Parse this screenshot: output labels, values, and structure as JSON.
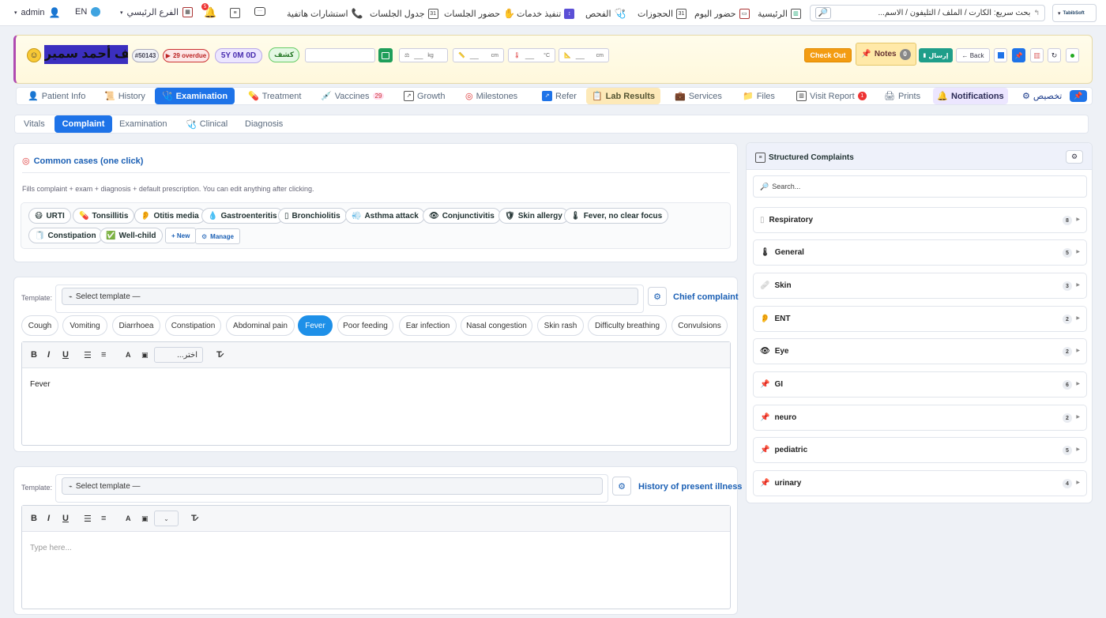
{
  "topnav": {
    "brand": "TabibSoft",
    "quick_search": "بحث سريع: الكارت / الملف / التليفون / الاسم...",
    "items": [
      {
        "label": "الرئيسية",
        "icon": "chart-icon"
      },
      {
        "label": "حضور اليوم",
        "icon": "calendar-icon"
      },
      {
        "label": "الحجوزات",
        "icon": "calendar-icon"
      },
      {
        "label": "الفحص",
        "icon": "stethoscope-icon"
      },
      {
        "label": "تنفيذ خدمات",
        "icon": "service-icon"
      },
      {
        "label": "حضور الجلسات",
        "icon": "hand-icon"
      },
      {
        "label": "جدول الجلسات",
        "icon": "calendar-icon"
      },
      {
        "label": "استشارات هاتفية",
        "icon": "phone-icon"
      }
    ],
    "branch": "الفرع الرئيسي",
    "notif_badge": "5",
    "lang": "EN",
    "user": "admin"
  },
  "patient": {
    "name": "يوسف أحمد سمير",
    "id": "#50143",
    "overdue": "29 overdue",
    "age": "5Y 0M 0D",
    "visit_type": "كشف",
    "weight_unit": "kg",
    "height_unit": "cm",
    "temp_unit": "°C",
    "head_unit": "cm",
    "placeholder_dash": "__",
    "checkout": "Check Out",
    "notes": "Notes",
    "notes_count": "0",
    "send": "إرسال",
    "back": "← Back"
  },
  "main_tabs": [
    {
      "label": "Patient Info",
      "icon": "person-icon"
    },
    {
      "label": "History",
      "icon": "scroll-icon"
    },
    {
      "label": "Examination",
      "icon": "stethoscope-icon"
    },
    {
      "label": "Treatment",
      "icon": "pill-icon"
    },
    {
      "label": "Vaccines",
      "icon": "syringe-icon",
      "badge": "29"
    },
    {
      "label": "Growth",
      "icon": "chart-icon"
    },
    {
      "label": "Milestones",
      "icon": "target-icon"
    },
    {
      "label": "Refer",
      "icon": "share-icon"
    },
    {
      "label": "Lab Results",
      "icon": "clipboard-icon"
    },
    {
      "label": "Services",
      "icon": "bag-icon"
    },
    {
      "label": "Files",
      "icon": "folder-icon"
    },
    {
      "label": "Visit Report",
      "icon": "report-icon",
      "badge": "1"
    },
    {
      "label": "Prints",
      "icon": "printer-icon"
    },
    {
      "label": "Notifications",
      "icon": "bell-icon"
    },
    {
      "label": "تخصيص",
      "icon": "gear-icon"
    }
  ],
  "sub_tabs": [
    "Vitals",
    "Complaint",
    "Examination",
    "Clinical",
    "Diagnosis"
  ],
  "common_cases": {
    "title": "Common cases (one click)",
    "hint": "Fills complaint + exam + diagnosis + default prescription. You can edit anything after clicking.",
    "chips": [
      {
        "label": "URTI",
        "icon": "😷"
      },
      {
        "label": "Tonsillitis",
        "icon": "💊"
      },
      {
        "label": "Otitis media",
        "icon": "👂"
      },
      {
        "label": "Gastroenteritis",
        "icon": "💧"
      },
      {
        "label": "Bronchiolitis",
        "icon": "▯"
      },
      {
        "label": "Asthma attack",
        "icon": "💨"
      },
      {
        "label": "Conjunctivitis",
        "icon": "👁"
      },
      {
        "label": "Skin allergy",
        "icon": "🛡"
      },
      {
        "label": "Fever, no clear focus",
        "icon": "🌡"
      },
      {
        "label": "Constipation",
        "icon": "🧻"
      },
      {
        "label": "Well-child",
        "icon": "✅"
      }
    ],
    "new": "+ New",
    "manage": "Manage"
  },
  "chief": {
    "template_label": "Template:",
    "template_placeholder": "Select template —",
    "title": "Chief complaint",
    "chips": [
      "Cough",
      "Vomiting",
      "Diarrhoea",
      "Constipation",
      "Abdominal pain",
      "Fever",
      "Poor feeding",
      "Ear infection",
      "Nasal congestion",
      "Skin rash",
      "Difficulty breathing",
      "Convulsions"
    ],
    "active": "Fever",
    "size_select": "اختر...",
    "text": "Fever"
  },
  "hpi": {
    "template_label": "Template:",
    "template_placeholder": "Select template —",
    "title": "History of present illness",
    "placeholder": "Type here..."
  },
  "structured": {
    "title": "Structured Complaints",
    "search_placeholder": "Search...",
    "groups": [
      {
        "label": "Respiratory",
        "icon": "▯",
        "count": "8"
      },
      {
        "label": "General",
        "icon": "🌡",
        "count": "5"
      },
      {
        "label": "Skin",
        "icon": "🩹",
        "count": "3"
      },
      {
        "label": "ENT",
        "icon": "👂",
        "count": "2"
      },
      {
        "label": "Eye",
        "icon": "👁",
        "count": "2"
      },
      {
        "label": "GI",
        "icon": "📌",
        "count": "6"
      },
      {
        "label": "neuro",
        "icon": "📌",
        "count": "2"
      },
      {
        "label": "pediatric",
        "icon": "📌",
        "count": "5"
      },
      {
        "label": "urinary",
        "icon": "📌",
        "count": "4"
      }
    ]
  },
  "colors": {
    "accent": "#1e73e8",
    "checkout": "#f39c12",
    "send": "#1f9e8a",
    "name_bg": "#3b2fbf"
  }
}
